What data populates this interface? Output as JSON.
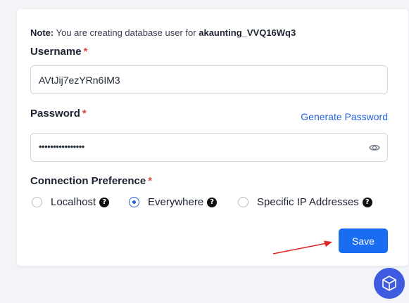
{
  "note": {
    "prefix": "Note:",
    "text": "You are creating database user for",
    "database": "akaunting_VVQ16Wq3"
  },
  "username": {
    "label": "Username",
    "required_mark": "*",
    "value": "AVtJij7ezYRn6IM3"
  },
  "password": {
    "label": "Password",
    "required_mark": "*",
    "generate_link": "Generate Password",
    "masked_value": "••••••••••••••••",
    "toggle_icon": "eye-icon"
  },
  "connection": {
    "label": "Connection Preference",
    "required_mark": "*",
    "options": [
      {
        "label": "Localhost",
        "selected": false
      },
      {
        "label": "Everywhere",
        "selected": true
      },
      {
        "label": "Specific IP Addresses",
        "selected": false
      }
    ],
    "help_glyph": "?"
  },
  "actions": {
    "save_label": "Save"
  },
  "colors": {
    "primary": "#1a6cf0",
    "link": "#2563d9",
    "required": "#e0463a",
    "annotation_arrow": "#e02424"
  }
}
